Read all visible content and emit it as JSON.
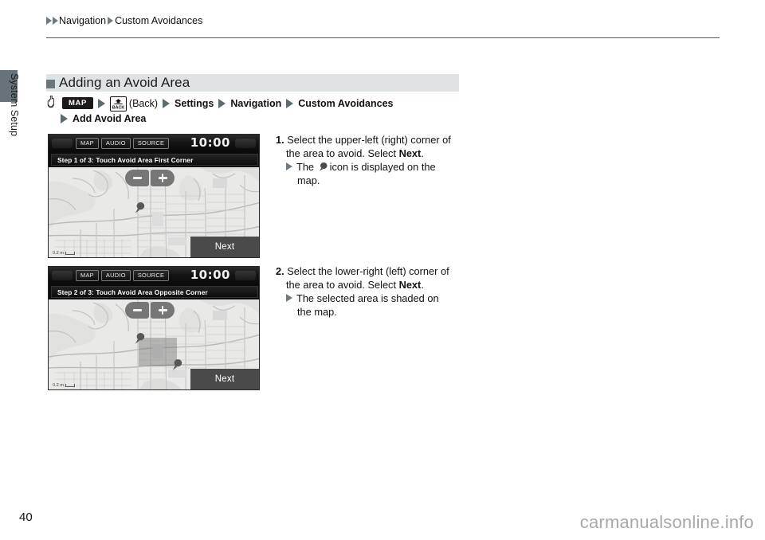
{
  "sidebar": {
    "tab_label": "System Setup"
  },
  "breadcrumb": {
    "items": [
      "Navigation",
      "Custom Avoidances"
    ]
  },
  "section": {
    "heading": "Adding an Avoid Area"
  },
  "nav_path": {
    "hand_icon": "hand-pointer-icon",
    "map_key": "MAP",
    "back_key": "BACK",
    "back_label": "(Back)",
    "step_settings": "Settings",
    "step_navigation": "Navigation",
    "step_custom_avoidances": "Custom Avoidances",
    "step_add_avoid_area": "Add Avoid Area"
  },
  "instructions": [
    {
      "number": "1.",
      "line1": "Select the upper-left (right) corner",
      "line2_pre": "of the area to avoid. Select ",
      "line2_bold": "Next",
      "line2_post": ".",
      "sub_pre": "The ",
      "sub_icon": "map-pin-icon",
      "sub_post": "icon is displayed on the",
      "sub_cont": "map."
    },
    {
      "number": "2.",
      "line1": "Select the lower-right (left) corner",
      "line2_pre": "of the area to avoid. Select ",
      "line2_bold": "Next",
      "line2_post": ".",
      "sub_pre": "The selected area is shaded on",
      "sub_icon": "",
      "sub_post": "",
      "sub_cont": "the map."
    }
  ],
  "screens": [
    {
      "buttons": {
        "map": "MAP",
        "audio": "AUDIO",
        "source": "SOURCE"
      },
      "clock": "10:00",
      "step_text": "Step 1 of 3: Touch Avoid Area First Corner",
      "zoom_out": "−",
      "zoom_in": "+",
      "next_label": "Next",
      "scale_label": "0.2 m",
      "pins": 1,
      "shaded": false
    },
    {
      "buttons": {
        "map": "MAP",
        "audio": "AUDIO",
        "source": "SOURCE"
      },
      "clock": "10:00",
      "step_text": "Step 2 of 3: Touch Avoid Area Opposite Corner",
      "zoom_out": "−",
      "zoom_in": "+",
      "next_label": "Next",
      "scale_label": "0.2 m",
      "pins": 2,
      "shaded": true
    }
  ],
  "footer": {
    "page_number": "40",
    "watermark": "carmanualsonline.info"
  },
  "colors": {
    "tab": "#667479",
    "triangle": "#6f7b80",
    "heading_band": "#dfe3e3",
    "rule": "#4d5a5f",
    "screen_bg": "#0b0b0b",
    "map_bg": "#e9e9e7"
  }
}
